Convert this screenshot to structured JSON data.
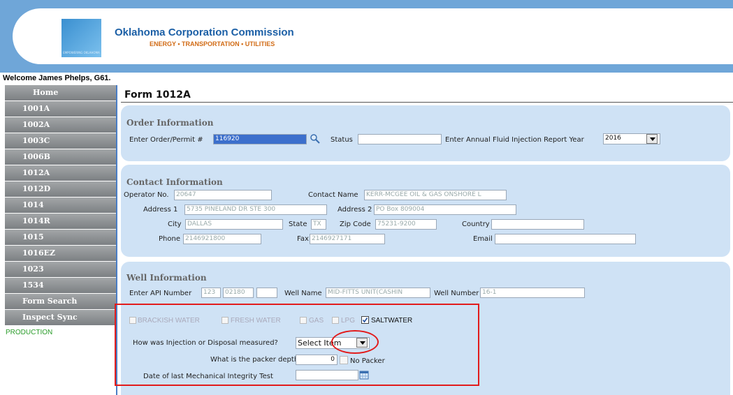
{
  "header": {
    "org_name": "Oklahoma Corporation Commission",
    "org_subtitle": "ENERGY • TRANSPORTATION • UTILITIES",
    "logo_text": "EMPOWERING OKLAHOMA"
  },
  "welcome": "Welcome James Phelps, G61.",
  "sidebar": {
    "items": [
      {
        "label": "Home"
      },
      {
        "label": "1001A"
      },
      {
        "label": "1002A"
      },
      {
        "label": "1003C"
      },
      {
        "label": "1006B"
      },
      {
        "label": "1012A"
      },
      {
        "label": "1012D"
      },
      {
        "label": "1014"
      },
      {
        "label": "1014R"
      },
      {
        "label": "1015"
      },
      {
        "label": "1016EZ"
      },
      {
        "label": "1023"
      },
      {
        "label": "1534"
      },
      {
        "label": "Form Search"
      },
      {
        "label": "Inspect Sync"
      }
    ],
    "environment": "PRODUCTION"
  },
  "form": {
    "title": "Form 1012A"
  },
  "order": {
    "title": "Order Information",
    "permit_label": "Enter Order/Permit #",
    "permit_value": "116920",
    "status_label": "Status",
    "status_value": "",
    "year_label": "Enter Annual Fluid Injection Report Year",
    "year_value": "2016"
  },
  "contact": {
    "title": "Contact Information",
    "operator_label": "Operator No.",
    "operator_value": "20647",
    "contact_name_label": "Contact Name",
    "contact_name_value": "KERR-MCGEE OIL & GAS ONSHORE L",
    "address1_label": "Address 1",
    "address1_value": "5735 PINELAND DR STE 300",
    "address2_label": "Address 2",
    "address2_value": "PO Box 809004",
    "city_label": "City",
    "city_value": "DALLAS",
    "state_label": "State",
    "state_value": "TX",
    "zip_label": "Zip Code",
    "zip_value": "75231-9200",
    "country_label": "Country",
    "country_value": "",
    "phone_label": "Phone",
    "phone_value": "2146921800",
    "fax_label": "Fax",
    "fax_value": "2146927171",
    "email_label": "Email",
    "email_value": ""
  },
  "well": {
    "title": "Well Information",
    "api_label": "Enter API Number",
    "api_part1": "123",
    "api_part2": "02180",
    "api_part3": "",
    "well_name_label": "Well Name",
    "well_name_value": "MID-FITTS UNIT(CASHIN",
    "well_number_label": "Well Number",
    "well_number_value": "16-1",
    "fluid_types": [
      {
        "label": "BRACKISH WATER",
        "checked": false
      },
      {
        "label": "FRESH WATER",
        "checked": false
      },
      {
        "label": "GAS",
        "checked": false
      },
      {
        "label": "LPG",
        "checked": false
      },
      {
        "label": "SALTWATER",
        "checked": true
      }
    ],
    "measured_label": "How was Injection or Disposal measured?",
    "measured_value": "Select Item",
    "packer_label": "What is the packer depth?",
    "packer_value": "0",
    "no_packer_label": "No Packer",
    "mit_label": "Date of last Mechanical Integrity Test",
    "mit_value": ""
  },
  "colors": {
    "header_blue": "#6fa6d8",
    "panel_blue": "#cfe2f5",
    "sidebar_gray": "#8d9093",
    "annotation_red": "#e21b1b"
  }
}
